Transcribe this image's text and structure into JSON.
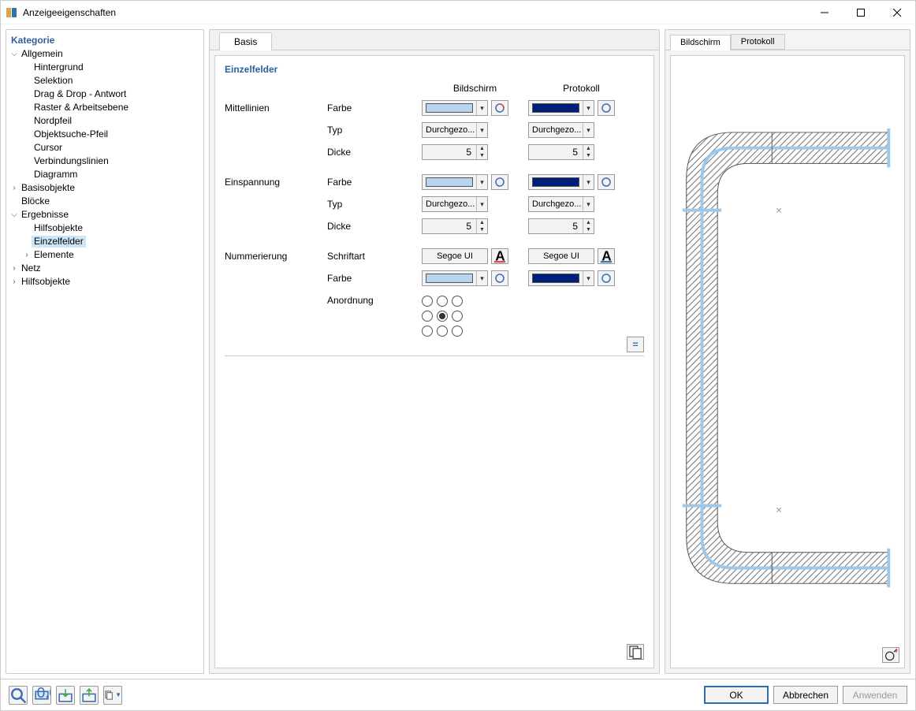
{
  "window": {
    "title": "Anzeigeeigenschaften"
  },
  "sidebar": {
    "title": "Kategorie",
    "tree": {
      "allgemein": {
        "label": "Allgemein",
        "expanded": true,
        "children": {
          "hintergrund": "Hintergrund",
          "selektion": "Selektion",
          "dragdrop": "Drag & Drop - Antwort",
          "raster": "Raster & Arbeitsebene",
          "nordpfeil": "Nordpfeil",
          "objektsuche": "Objektsuche-Pfeil",
          "cursor": "Cursor",
          "verbindungslinien": "Verbindungslinien",
          "diagramm": "Diagramm"
        }
      },
      "basisobjekte": {
        "label": "Basisobjekte",
        "expanded": false
      },
      "bloecke": {
        "label": "Blöcke",
        "expanded": false
      },
      "ergebnisse": {
        "label": "Ergebnisse",
        "expanded": true,
        "children": {
          "hilfsobjekte": "Hilfsobjekte",
          "einzelfelder": "Einzelfelder",
          "elemente": "Elemente"
        }
      },
      "netz": {
        "label": "Netz",
        "expanded": false
      },
      "hilfsobjekte2": {
        "label": "Hilfsobjekte",
        "expanded": false
      }
    },
    "selected": "Einzelfelder"
  },
  "tabs": {
    "basis": "Basis"
  },
  "section": {
    "title": "Einzelfelder"
  },
  "columns": {
    "screen": "Bildschirm",
    "protocol": "Protokoll"
  },
  "groups": {
    "mittellinien": {
      "label": "Mittellinien",
      "farbe": {
        "label": "Farbe",
        "screen_color": "#b8d4f0",
        "protocol_color": "#001f7a"
      },
      "typ": {
        "label": "Typ",
        "screen": "Durchgezo...",
        "protocol": "Durchgezo..."
      },
      "dicke": {
        "label": "Dicke",
        "screen": "5",
        "protocol": "5"
      }
    },
    "einspannung": {
      "label": "Einspannung",
      "farbe": {
        "label": "Farbe",
        "screen_color": "#b8d4f0",
        "protocol_color": "#001f7a"
      },
      "typ": {
        "label": "Typ",
        "screen": "Durchgezo...",
        "protocol": "Durchgezo..."
      },
      "dicke": {
        "label": "Dicke",
        "screen": "5",
        "protocol": "5"
      }
    },
    "nummerierung": {
      "label": "Nummerierung",
      "schriftart": {
        "label": "Schriftart",
        "screen": "Segoe UI",
        "protocol": "Segoe UI"
      },
      "farbe": {
        "label": "Farbe",
        "screen_color": "#b8d4f0",
        "protocol_color": "#001f7a"
      },
      "anordnung": {
        "label": "Anordnung",
        "selected": 4
      }
    }
  },
  "preview_tabs": {
    "screen": "Bildschirm",
    "protocol": "Protokoll"
  },
  "buttons": {
    "ok": "OK",
    "cancel": "Abbrechen",
    "apply": "Anwenden"
  }
}
